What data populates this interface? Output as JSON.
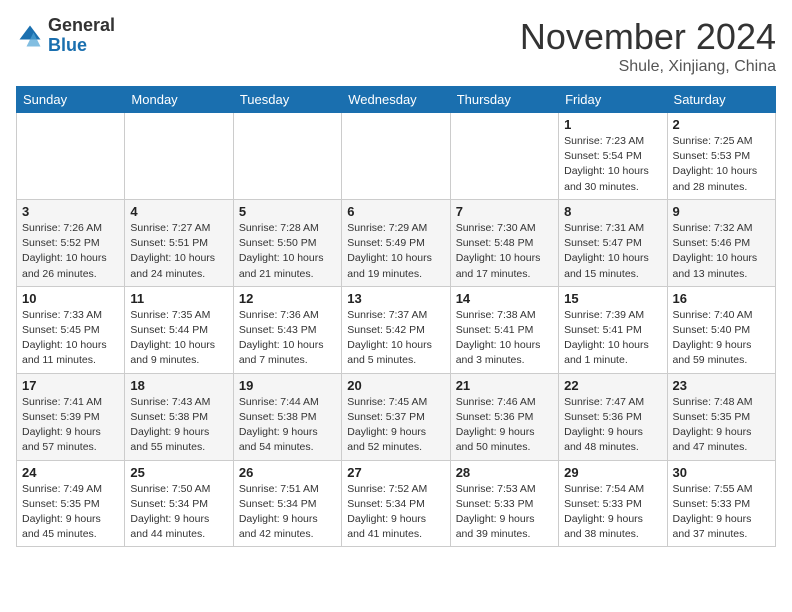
{
  "header": {
    "logo_general": "General",
    "logo_blue": "Blue",
    "month_title": "November 2024",
    "location": "Shule, Xinjiang, China"
  },
  "weekdays": [
    "Sunday",
    "Monday",
    "Tuesday",
    "Wednesday",
    "Thursday",
    "Friday",
    "Saturday"
  ],
  "weeks": [
    [
      {
        "day": "",
        "info": ""
      },
      {
        "day": "",
        "info": ""
      },
      {
        "day": "",
        "info": ""
      },
      {
        "day": "",
        "info": ""
      },
      {
        "day": "",
        "info": ""
      },
      {
        "day": "1",
        "info": "Sunrise: 7:23 AM\nSunset: 5:54 PM\nDaylight: 10 hours and 30 minutes."
      },
      {
        "day": "2",
        "info": "Sunrise: 7:25 AM\nSunset: 5:53 PM\nDaylight: 10 hours and 28 minutes."
      }
    ],
    [
      {
        "day": "3",
        "info": "Sunrise: 7:26 AM\nSunset: 5:52 PM\nDaylight: 10 hours and 26 minutes."
      },
      {
        "day": "4",
        "info": "Sunrise: 7:27 AM\nSunset: 5:51 PM\nDaylight: 10 hours and 24 minutes."
      },
      {
        "day": "5",
        "info": "Sunrise: 7:28 AM\nSunset: 5:50 PM\nDaylight: 10 hours and 21 minutes."
      },
      {
        "day": "6",
        "info": "Sunrise: 7:29 AM\nSunset: 5:49 PM\nDaylight: 10 hours and 19 minutes."
      },
      {
        "day": "7",
        "info": "Sunrise: 7:30 AM\nSunset: 5:48 PM\nDaylight: 10 hours and 17 minutes."
      },
      {
        "day": "8",
        "info": "Sunrise: 7:31 AM\nSunset: 5:47 PM\nDaylight: 10 hours and 15 minutes."
      },
      {
        "day": "9",
        "info": "Sunrise: 7:32 AM\nSunset: 5:46 PM\nDaylight: 10 hours and 13 minutes."
      }
    ],
    [
      {
        "day": "10",
        "info": "Sunrise: 7:33 AM\nSunset: 5:45 PM\nDaylight: 10 hours and 11 minutes."
      },
      {
        "day": "11",
        "info": "Sunrise: 7:35 AM\nSunset: 5:44 PM\nDaylight: 10 hours and 9 minutes."
      },
      {
        "day": "12",
        "info": "Sunrise: 7:36 AM\nSunset: 5:43 PM\nDaylight: 10 hours and 7 minutes."
      },
      {
        "day": "13",
        "info": "Sunrise: 7:37 AM\nSunset: 5:42 PM\nDaylight: 10 hours and 5 minutes."
      },
      {
        "day": "14",
        "info": "Sunrise: 7:38 AM\nSunset: 5:41 PM\nDaylight: 10 hours and 3 minutes."
      },
      {
        "day": "15",
        "info": "Sunrise: 7:39 AM\nSunset: 5:41 PM\nDaylight: 10 hours and 1 minute."
      },
      {
        "day": "16",
        "info": "Sunrise: 7:40 AM\nSunset: 5:40 PM\nDaylight: 9 hours and 59 minutes."
      }
    ],
    [
      {
        "day": "17",
        "info": "Sunrise: 7:41 AM\nSunset: 5:39 PM\nDaylight: 9 hours and 57 minutes."
      },
      {
        "day": "18",
        "info": "Sunrise: 7:43 AM\nSunset: 5:38 PM\nDaylight: 9 hours and 55 minutes."
      },
      {
        "day": "19",
        "info": "Sunrise: 7:44 AM\nSunset: 5:38 PM\nDaylight: 9 hours and 54 minutes."
      },
      {
        "day": "20",
        "info": "Sunrise: 7:45 AM\nSunset: 5:37 PM\nDaylight: 9 hours and 52 minutes."
      },
      {
        "day": "21",
        "info": "Sunrise: 7:46 AM\nSunset: 5:36 PM\nDaylight: 9 hours and 50 minutes."
      },
      {
        "day": "22",
        "info": "Sunrise: 7:47 AM\nSunset: 5:36 PM\nDaylight: 9 hours and 48 minutes."
      },
      {
        "day": "23",
        "info": "Sunrise: 7:48 AM\nSunset: 5:35 PM\nDaylight: 9 hours and 47 minutes."
      }
    ],
    [
      {
        "day": "24",
        "info": "Sunrise: 7:49 AM\nSunset: 5:35 PM\nDaylight: 9 hours and 45 minutes."
      },
      {
        "day": "25",
        "info": "Sunrise: 7:50 AM\nSunset: 5:34 PM\nDaylight: 9 hours and 44 minutes."
      },
      {
        "day": "26",
        "info": "Sunrise: 7:51 AM\nSunset: 5:34 PM\nDaylight: 9 hours and 42 minutes."
      },
      {
        "day": "27",
        "info": "Sunrise: 7:52 AM\nSunset: 5:34 PM\nDaylight: 9 hours and 41 minutes."
      },
      {
        "day": "28",
        "info": "Sunrise: 7:53 AM\nSunset: 5:33 PM\nDaylight: 9 hours and 39 minutes."
      },
      {
        "day": "29",
        "info": "Sunrise: 7:54 AM\nSunset: 5:33 PM\nDaylight: 9 hours and 38 minutes."
      },
      {
        "day": "30",
        "info": "Sunrise: 7:55 AM\nSunset: 5:33 PM\nDaylight: 9 hours and 37 minutes."
      }
    ]
  ]
}
